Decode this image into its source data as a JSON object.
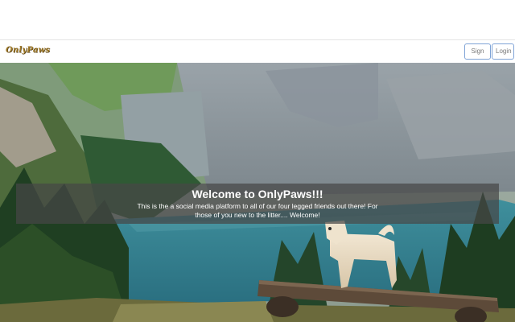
{
  "navbar": {
    "brand": "OnlyPaws",
    "signup_label": "Sign Up",
    "login_label": "Login"
  },
  "hero": {
    "title": "Welcome to OnlyPaws!!!",
    "text": "This is the a social media platform to all of our four legged friends out there! For those of you new to the litter.... Welcome!"
  },
  "colors": {
    "brand": "#a07a28",
    "button_border": "#7fa3d6",
    "overlay": "#464646"
  }
}
